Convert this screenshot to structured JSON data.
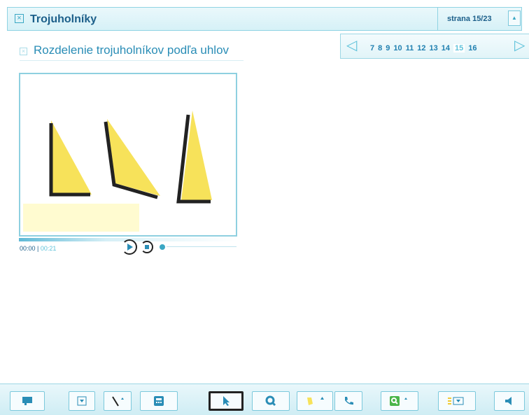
{
  "header": {
    "title": "Trojuholníky",
    "page_indicator": "strana 15/23"
  },
  "subheader": {
    "title": "Rozdelenie trojuholníkov podľa uhlov"
  },
  "pagenav": {
    "pages": [
      "7",
      "8",
      "9",
      "10",
      "11",
      "12",
      "13",
      "14",
      "15",
      "16"
    ],
    "current": "15"
  },
  "player": {
    "time_current": "00:00",
    "time_total": "00:21",
    "progress": 0
  },
  "toolbar": {
    "tools": [
      "comment-icon",
      "dropdown-icon",
      "line-tool-icon",
      "calculator-icon",
      "pointer-icon",
      "search-icon",
      "highlighter-icon",
      "phone-icon",
      "zoom-in-icon",
      "list-panel-icon",
      "speaker-icon"
    ]
  },
  "colors": {
    "accent": "#2a8db6",
    "title": "#1c5f8a",
    "triangle": "#f7e25a",
    "caption_bg": "#fffbd0"
  }
}
